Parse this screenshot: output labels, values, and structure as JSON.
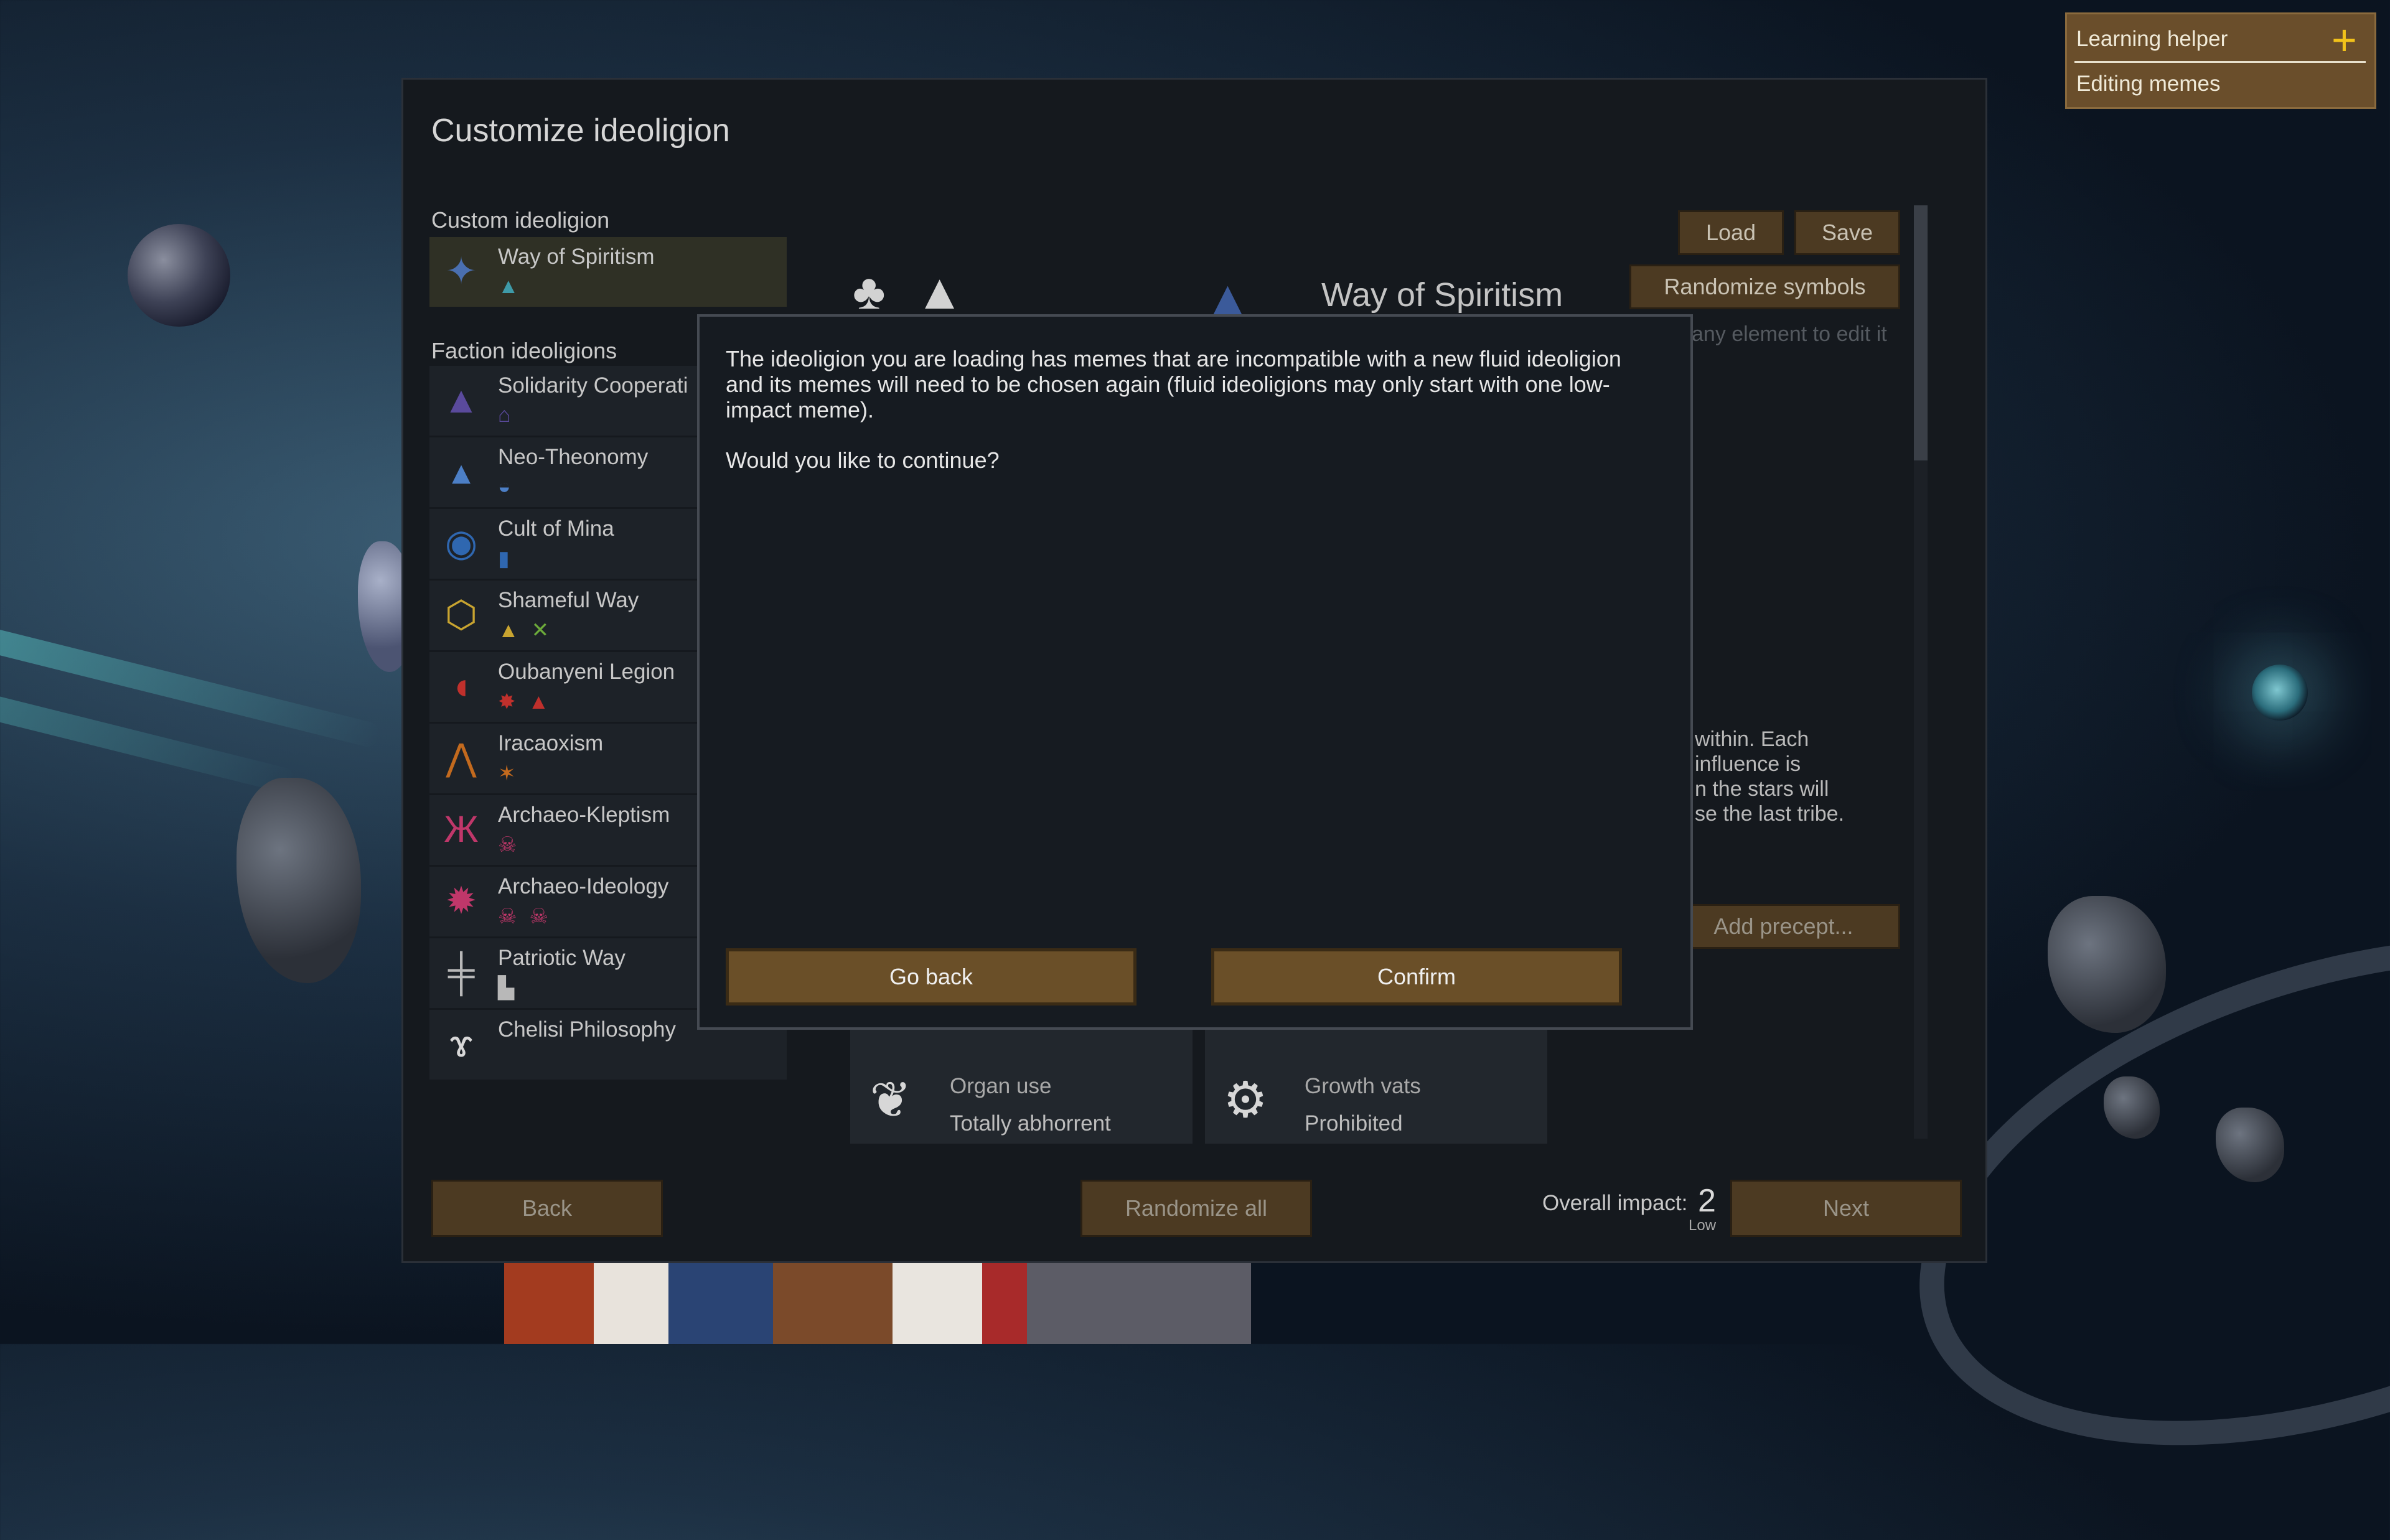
{
  "window": {
    "title": "Customize ideoligion",
    "custom_label": "Custom ideoligion",
    "faction_label": "Faction ideoligions"
  },
  "custom_ideoligion": {
    "name": "Way of Spiritism",
    "icon": "spirit-cross-icon",
    "meme_icons": [
      "tribal-a-icon"
    ]
  },
  "faction_ideoligions": [
    {
      "name": "Solidarity Cooperati",
      "icon": "triangle-icon",
      "meme_icons": [
        "house-icon"
      ]
    },
    {
      "name": "Neo-Theonomy",
      "icon": "bell-icon",
      "meme_icons": [
        "dome-icon"
      ]
    },
    {
      "name": "Cult of Mina",
      "icon": "eye-icon",
      "meme_icons": [
        "door-icon"
      ]
    },
    {
      "name": "Shameful Way",
      "icon": "triskelion-icon",
      "meme_icons": [
        "tribal-a-icon",
        "tribal-x-icon"
      ]
    },
    {
      "name": "Oubanyeni Legion",
      "icon": "crescent-icon",
      "meme_icons": [
        "spiky-icon",
        "tribal-a-icon"
      ]
    },
    {
      "name": "Iracaoxism",
      "icon": "bat-icon",
      "meme_icons": [
        "stick-figure-icon"
      ]
    },
    {
      "name": "Archaeo-Kleptism",
      "icon": "horned-icon",
      "meme_icons": [
        "skull-icon"
      ]
    },
    {
      "name": "Archaeo-Ideology",
      "icon": "cog-icon",
      "meme_icons": [
        "skull-icon",
        "skull-icon"
      ]
    },
    {
      "name": "Patriotic Way",
      "icon": "double-cross-icon",
      "meme_icons": [
        "column-icon"
      ]
    },
    {
      "name": "Chelisi Philosophy",
      "icon": "curl-icon",
      "meme_icons": []
    }
  ],
  "right_panel": {
    "ideo_name": "Way of Spiritism",
    "load_label": "Load",
    "save_label": "Save",
    "randomize_symbols_label": "Randomize symbols",
    "hint_text": "any element to edit it",
    "desc_lines": [
      "within. Each",
      "influence is",
      "n the stars will",
      "se the last tribe."
    ],
    "add_precept_label": "Add precept..."
  },
  "precepts": [
    {
      "title": "Organ use",
      "value": "Totally abhorrent",
      "icon": "organ-icon"
    },
    {
      "title": "Growth vats",
      "value": "Prohibited",
      "icon": "vat-icon"
    }
  ],
  "footer": {
    "back_label": "Back",
    "randomize_all_label": "Randomize all",
    "impact_label": "Overall impact:",
    "impact_value": "2",
    "impact_level": "Low",
    "next_label": "Next"
  },
  "dialog": {
    "message": "The ideoligion you are loading has memes that are incompatible with a new fluid ideoligion and its memes will need to be chosen again (fluid ideoligions may only start with one low-impact meme).",
    "question": "Would you like to continue?",
    "go_back_label": "Go back",
    "confirm_label": "Confirm"
  },
  "learning_helper": {
    "title": "Learning helper",
    "item": "Editing memes",
    "add_icon": "plus-icon"
  }
}
